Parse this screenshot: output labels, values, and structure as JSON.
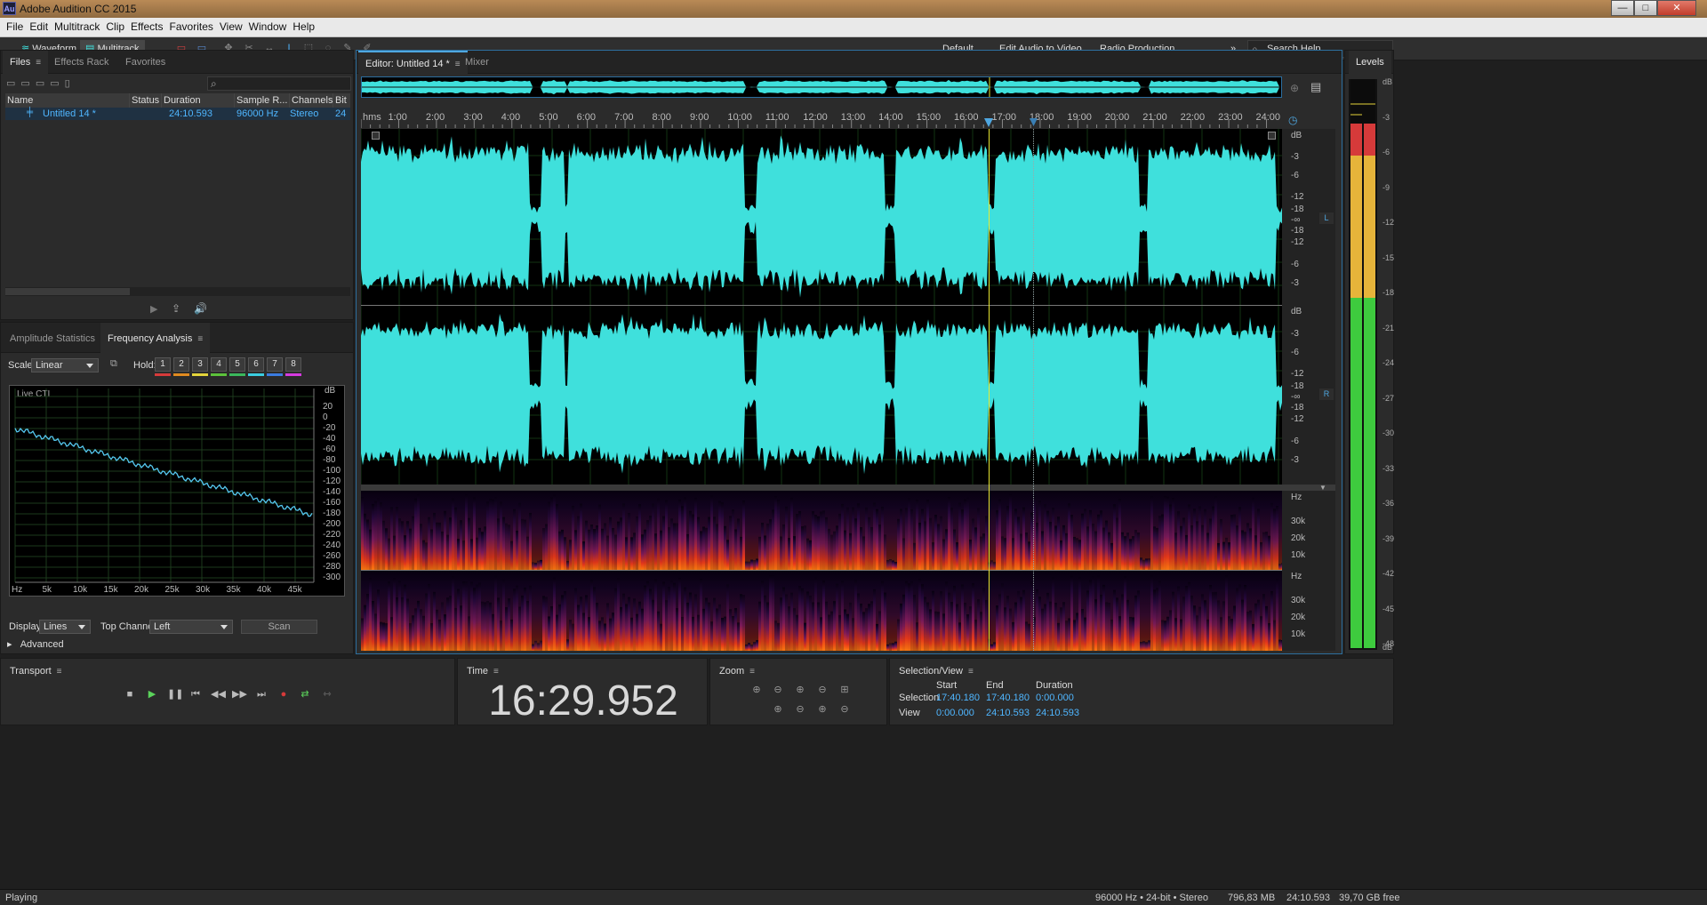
{
  "window": {
    "title": "Adobe Audition CC 2015",
    "logo": "Au",
    "buttons": [
      "—",
      "□",
      "✕"
    ]
  },
  "menu": [
    "File",
    "Edit",
    "Multitrack",
    "Clip",
    "Effects",
    "Favorites",
    "View",
    "Window",
    "Help"
  ],
  "toolbar": {
    "waveform": "Waveform",
    "multitrack": "Multitrack"
  },
  "workspaces": [
    "Default",
    "Edit Audio to Video",
    "Radio Production"
  ],
  "search_help": "Search Help",
  "files_panel": {
    "tabs": [
      "Files",
      "Effects Rack",
      "Favorites"
    ],
    "columns": [
      "Name",
      "Status",
      "Duration",
      "Sample R...",
      "Channels",
      "Bit D"
    ],
    "rows": [
      {
        "name": "Untitled 14 *",
        "status": "",
        "duration": "24:10.593",
        "sample_rate": "96000 Hz",
        "channels": "Stereo",
        "bit_depth": "24"
      }
    ]
  },
  "analysis_panel": {
    "tabs": [
      "Amplitude Statistics",
      "Frequency Analysis"
    ],
    "scale_label": "Scale:",
    "scale_value": "Linear",
    "hold_label": "Hold:",
    "hold": [
      "1",
      "2",
      "3",
      "4",
      "5",
      "6",
      "7",
      "8"
    ],
    "hold_colors": [
      "#d63a3a",
      "#e08a20",
      "#e3d43a",
      "#5cc23a",
      "#3ab85c",
      "#3acde0",
      "#3a7be0",
      "#d63ae0"
    ],
    "live_cti": "Live CTI",
    "db_unit": "dB",
    "db_ticks": [
      "20",
      "0",
      "-20",
      "-40",
      "-60",
      "-80",
      "-100",
      "-120",
      "-140",
      "-160",
      "-180",
      "-200",
      "-220",
      "-240",
      "-260",
      "-280",
      "-300"
    ],
    "hz_ticks": [
      "Hz",
      "5k",
      "10k",
      "15k",
      "20k",
      "25k",
      "30k",
      "35k",
      "40k",
      "45k"
    ],
    "display_label": "Display:",
    "display_value": "Lines",
    "top_channel_label": "Top Channel:",
    "top_channel_value": "Left",
    "scan": "Scan",
    "advanced": "Advanced"
  },
  "editor": {
    "tabs": [
      "Editor: Untitled 14 *",
      "Mixer"
    ],
    "ruler": [
      "hms",
      "1:00",
      "2:00",
      "3:00",
      "4:00",
      "5:00",
      "6:00",
      "7:00",
      "8:00",
      "9:00",
      "10:00",
      "11:00",
      "12:00",
      "13:00",
      "14:00",
      "15:00",
      "16:00",
      "17:00",
      "18:00",
      "19:00",
      "20:00",
      "21:00",
      "22:00",
      "23:00",
      "24:00"
    ],
    "db_scale_unit": "dB",
    "db_scale": [
      "-3",
      "-6",
      "-12",
      "-18",
      "-∞",
      "-18",
      "-12",
      "-6",
      "-3"
    ],
    "channel_L": "L",
    "channel_R": "R",
    "hz_unit": "Hz",
    "spectral_ticks": [
      "30k",
      "20k",
      "10k"
    ],
    "waveform_color": "#3fe0dc",
    "playhead_color": "#e8e830"
  },
  "levels": {
    "title": "Levels",
    "ticks": [
      "dB",
      "-3",
      "-6",
      "-9",
      "-12",
      "-15",
      "-18",
      "-21",
      "-24",
      "-27",
      "-30",
      "-33",
      "-36",
      "-39",
      "-42",
      "-45",
      "-48",
      "-51",
      "dB"
    ]
  },
  "transport": {
    "title": "Transport"
  },
  "time": {
    "title": "Time",
    "value": "16:29.952"
  },
  "zoom": {
    "title": "Zoom"
  },
  "selection_view": {
    "title": "Selection/View",
    "headers": [
      "Start",
      "End",
      "Duration"
    ],
    "selection_label": "Selection",
    "selection": [
      "17:40.180",
      "17:40.180",
      "0:00.000"
    ],
    "view_label": "View",
    "view": [
      "0:00.000",
      "24:10.593",
      "24:10.593"
    ]
  },
  "status": {
    "state": "Playing",
    "format": "96000 Hz • 24-bit • Stereo",
    "size": "796,83 MB",
    "duration": "24:10.593",
    "free": "39,70 GB free"
  }
}
